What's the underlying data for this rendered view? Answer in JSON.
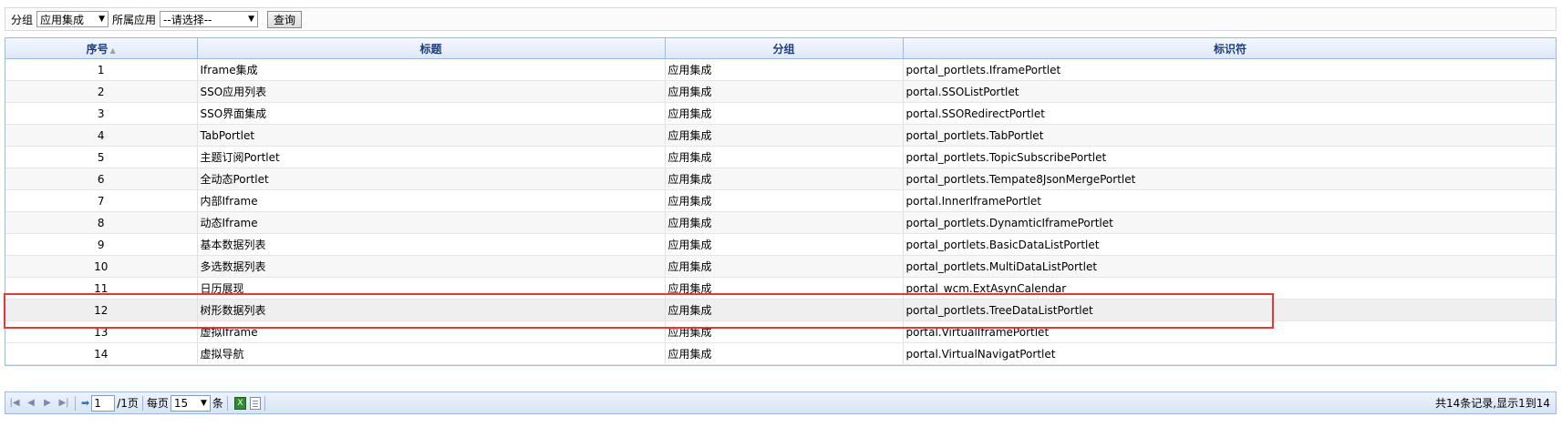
{
  "filter": {
    "group_label": "分组",
    "group_value": "应用集成",
    "app_label": "所属应用",
    "app_value": "--请选择--",
    "query_button": "查询"
  },
  "grid": {
    "columns": [
      "序号",
      "标题",
      "分组",
      "标识符"
    ],
    "rows": [
      {
        "no": "1",
        "title": "Iframe集成",
        "group": "应用集成",
        "id": "portal_portlets.IframePortlet"
      },
      {
        "no": "2",
        "title": "SSO应用列表",
        "group": "应用集成",
        "id": "portal.SSOListPortlet"
      },
      {
        "no": "3",
        "title": "SSO界面集成",
        "group": "应用集成",
        "id": "portal.SSORedirectPortlet"
      },
      {
        "no": "4",
        "title": "TabPortlet",
        "group": "应用集成",
        "id": "portal_portlets.TabPortlet"
      },
      {
        "no": "5",
        "title": "主题订阅Portlet",
        "group": "应用集成",
        "id": "portal_portlets.TopicSubscribePortlet"
      },
      {
        "no": "6",
        "title": "全动态Portlet",
        "group": "应用集成",
        "id": "portal_portlets.Tempate8JsonMergePortlet"
      },
      {
        "no": "7",
        "title": "内部Iframe",
        "group": "应用集成",
        "id": "portal.InnerIframePortlet"
      },
      {
        "no": "8",
        "title": "动态Iframe",
        "group": "应用集成",
        "id": "portal_portlets.DynamticIframePortlet"
      },
      {
        "no": "9",
        "title": "基本数据列表",
        "group": "应用集成",
        "id": "portal_portlets.BasicDataListPortlet"
      },
      {
        "no": "10",
        "title": "多选数据列表",
        "group": "应用集成",
        "id": "portal_portlets.MultiDataListPortlet"
      },
      {
        "no": "11",
        "title": "日历展现",
        "group": "应用集成",
        "id": "portal_wcm.ExtAsynCalendar"
      },
      {
        "no": "12",
        "title": "树形数据列表",
        "group": "应用集成",
        "id": "portal_portlets.TreeDataListPortlet"
      },
      {
        "no": "13",
        "title": "虚拟Iframe",
        "group": "应用集成",
        "id": "portal.VirtualIframePortlet"
      },
      {
        "no": "14",
        "title": "虚拟导航",
        "group": "应用集成",
        "id": "portal.VirtualNavigatPortlet"
      }
    ]
  },
  "pager": {
    "page_value": "1",
    "page_total": "/1页",
    "per_page_label": "每页",
    "per_page_value": "15",
    "per_page_unit": "条",
    "summary": "共14条记录,显示1到14"
  },
  "colors": {
    "header_text": "#1e3d7c",
    "border": "#99bbe8",
    "highlight": "#e53935"
  }
}
